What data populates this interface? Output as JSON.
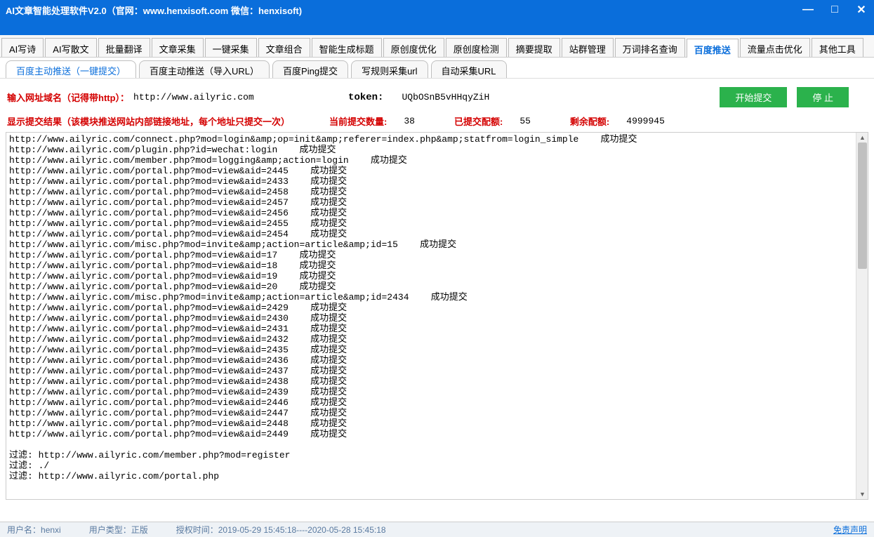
{
  "title": "AI文章智能处理软件V2.0（官网：www.henxisoft.com  微信：henxisoft)",
  "main_tabs": [
    "AI写诗",
    "AI写散文",
    "批量翻译",
    "文章采集",
    "一键采集",
    "文章组合",
    "智能生成标题",
    "原创度优化",
    "原创度检测",
    "摘要提取",
    "站群管理",
    "万词排名查询",
    "百度推送",
    "流量点击优化",
    "其他工具"
  ],
  "main_tab_active": 12,
  "sub_tabs": [
    "百度主动推送（一键提交）",
    "百度主动推送（导入URL）",
    "百度Ping提交",
    "写规则采集url",
    "自动采集URL"
  ],
  "sub_tab_active": 0,
  "form": {
    "url_label": "输入网址域名（记得带http）：",
    "url_value": "http://www.ailyric.com",
    "token_label": "token:",
    "token_value": "UQbOSnB5vHHqyZiH",
    "start_btn": "开始提交",
    "stop_btn": "停 止"
  },
  "status": {
    "result_label": "显示提交结果（该模块推送网站内部链接地址，每个地址只提交一次）",
    "current_label": "当前提交数量:",
    "current_value": "38",
    "submitted_label": "已提交配额:",
    "submitted_value": "55",
    "remain_label": "剩余配额:",
    "remain_value": "4999945"
  },
  "log_lines": [
    "http://www.ailyric.com/connect.php?mod=login&amp;op=init&amp;referer=index.php&amp;statfrom=login_simple    成功提交",
    "http://www.ailyric.com/plugin.php?id=wechat:login    成功提交",
    "http://www.ailyric.com/member.php?mod=logging&amp;action=login    成功提交",
    "http://www.ailyric.com/portal.php?mod=view&aid=2445    成功提交",
    "http://www.ailyric.com/portal.php?mod=view&aid=2433    成功提交",
    "http://www.ailyric.com/portal.php?mod=view&aid=2458    成功提交",
    "http://www.ailyric.com/portal.php?mod=view&aid=2457    成功提交",
    "http://www.ailyric.com/portal.php?mod=view&aid=2456    成功提交",
    "http://www.ailyric.com/portal.php?mod=view&aid=2455    成功提交",
    "http://www.ailyric.com/portal.php?mod=view&aid=2454    成功提交",
    "http://www.ailyric.com/misc.php?mod=invite&amp;action=article&amp;id=15    成功提交",
    "http://www.ailyric.com/portal.php?mod=view&aid=17    成功提交",
    "http://www.ailyric.com/portal.php?mod=view&aid=18    成功提交",
    "http://www.ailyric.com/portal.php?mod=view&aid=19    成功提交",
    "http://www.ailyric.com/portal.php?mod=view&aid=20    成功提交",
    "http://www.ailyric.com/misc.php?mod=invite&amp;action=article&amp;id=2434    成功提交",
    "http://www.ailyric.com/portal.php?mod=view&aid=2429    成功提交",
    "http://www.ailyric.com/portal.php?mod=view&aid=2430    成功提交",
    "http://www.ailyric.com/portal.php?mod=view&aid=2431    成功提交",
    "http://www.ailyric.com/portal.php?mod=view&aid=2432    成功提交",
    "http://www.ailyric.com/portal.php?mod=view&aid=2435    成功提交",
    "http://www.ailyric.com/portal.php?mod=view&aid=2436    成功提交",
    "http://www.ailyric.com/portal.php?mod=view&aid=2437    成功提交",
    "http://www.ailyric.com/portal.php?mod=view&aid=2438    成功提交",
    "http://www.ailyric.com/portal.php?mod=view&aid=2439    成功提交",
    "http://www.ailyric.com/portal.php?mod=view&aid=2446    成功提交",
    "http://www.ailyric.com/portal.php?mod=view&aid=2447    成功提交",
    "http://www.ailyric.com/portal.php?mod=view&aid=2448    成功提交",
    "http://www.ailyric.com/portal.php?mod=view&aid=2449    成功提交",
    "",
    "过滤: http://www.ailyric.com/member.php?mod=register",
    "过滤: ./",
    "过滤: http://www.ailyric.com/portal.php"
  ],
  "statusbar": {
    "user_label": "用户名：",
    "user_value": "henxi",
    "type_label": "用户类型：",
    "type_value": "正版",
    "auth_label": "授权时间：",
    "auth_value": "2019-05-29 15:45:18----2020-05-28 15:45:18",
    "disclaimer": "免责声明"
  }
}
